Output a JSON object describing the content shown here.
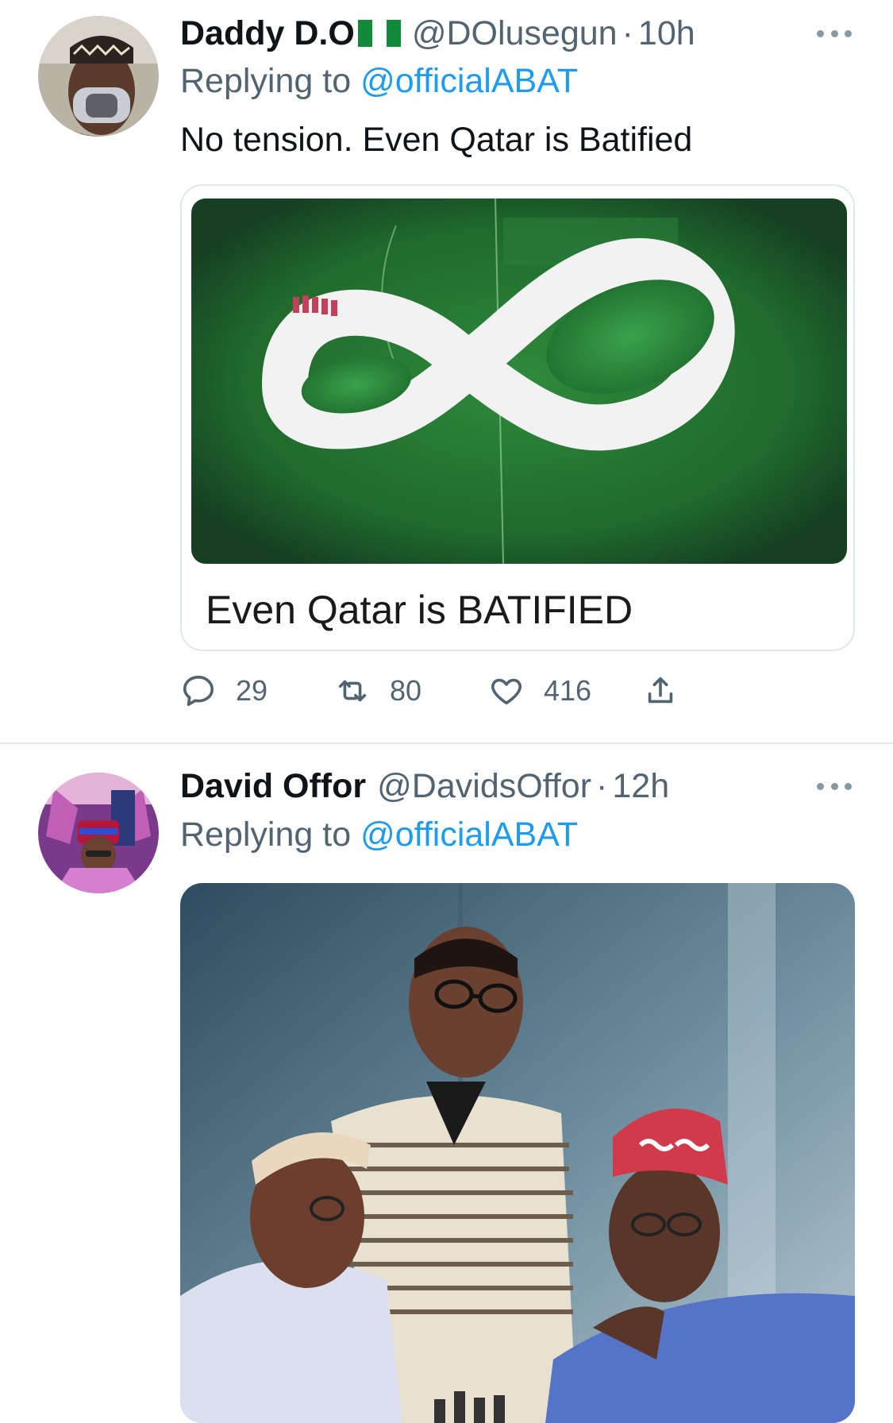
{
  "tweets": [
    {
      "name": "Daddy D.O",
      "flag": "Nigeria",
      "handle": "@DOlusegun",
      "time": "10h",
      "replying_prefix": "Replying to",
      "replying_mention": "@officialABAT",
      "text": "No tension. Even Qatar is Batified",
      "media_caption": "Even Qatar is BATIFIED",
      "stats": {
        "replies": "29",
        "retweets": "80",
        "likes": "416"
      }
    },
    {
      "name": "David Offor",
      "handle": "@DavidsOffor",
      "time": "12h",
      "replying_prefix": "Replying to",
      "replying_mention": "@officialABAT"
    }
  ],
  "icons": {
    "more": "more-horizontal-icon",
    "reply": "reply-icon",
    "retweet": "retweet-icon",
    "like": "heart-icon",
    "share": "share-icon"
  },
  "colors": {
    "link": "#1d9bf0",
    "secondary_text": "#536471",
    "divider": "#e1e8ed"
  }
}
